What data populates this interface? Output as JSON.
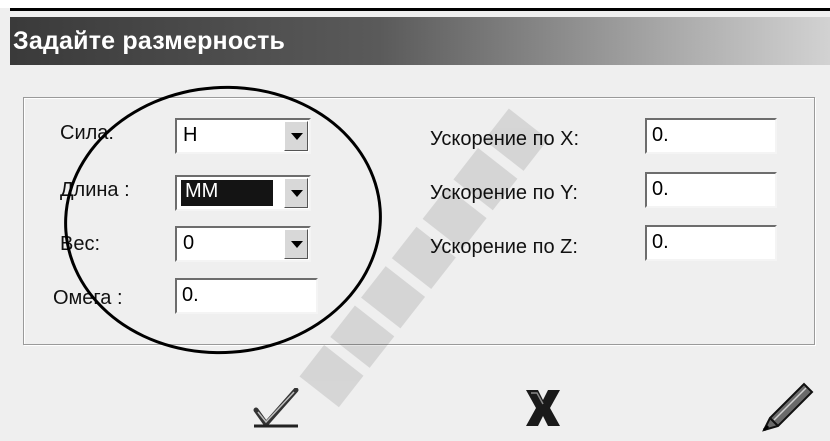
{
  "window": {
    "title": "Задайте размерность"
  },
  "fields": {
    "force": {
      "label": "Сила:",
      "value": "Н"
    },
    "length": {
      "label": "Длина :",
      "value": "ММ"
    },
    "weight": {
      "label": "Вес:",
      "value": "0"
    },
    "omega": {
      "label": "Омега :",
      "value": "0."
    },
    "accel_x": {
      "label": "Ускорение по X:",
      "value": "0."
    },
    "accel_y": {
      "label": "Ускорение по Y:",
      "value": "0."
    },
    "accel_z": {
      "label": "Ускорение по Z:",
      "value": "0."
    }
  },
  "buttons": {
    "ok": {
      "icon": "checkmark-icon"
    },
    "cancel": {
      "icon": "x-icon"
    },
    "edit": {
      "icon": "pen-icon"
    }
  },
  "colors": {
    "title_bar_start": "#3a3a3a",
    "title_bar_end": "#d2d2d2",
    "selection": "#141414"
  }
}
